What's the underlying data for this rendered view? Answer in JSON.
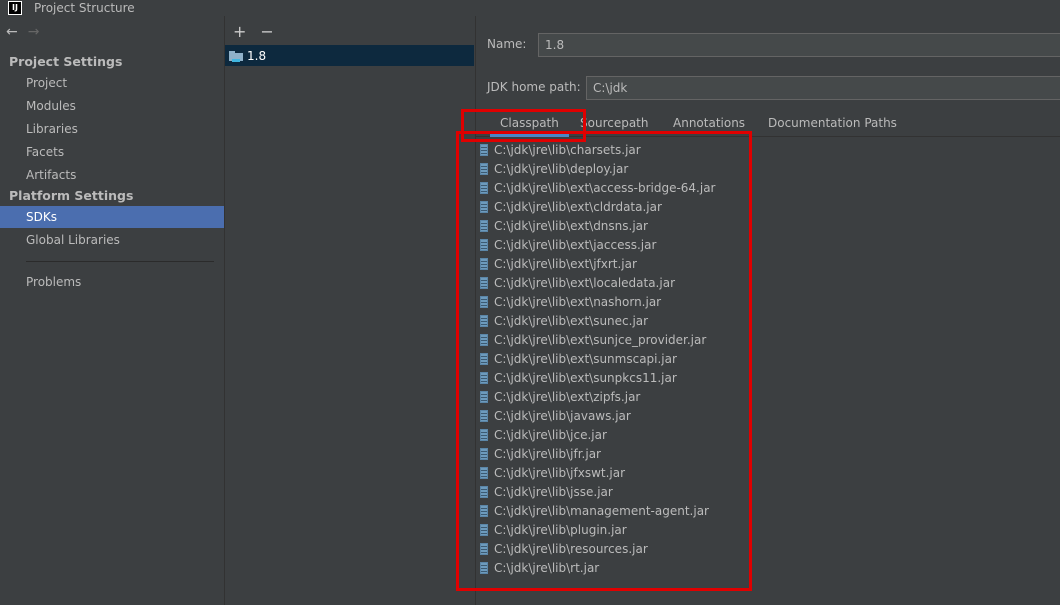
{
  "window": {
    "title": "Project Structure",
    "logo_text": "IJ"
  },
  "nav": {
    "back_glyph": "←",
    "forward_glyph": "→"
  },
  "sidebar": {
    "project_settings_header": "Project Settings",
    "platform_settings_header": "Platform Settings",
    "items": [
      {
        "label": "Project"
      },
      {
        "label": "Modules"
      },
      {
        "label": "Libraries"
      },
      {
        "label": "Facets"
      },
      {
        "label": "Artifacts"
      },
      {
        "label": "SDKs",
        "selected": true
      },
      {
        "label": "Global Libraries"
      },
      {
        "label": "Problems"
      }
    ]
  },
  "sdk_panel": {
    "add_glyph": "+",
    "remove_glyph": "−",
    "sdks": [
      {
        "name": "1.8",
        "selected": true
      }
    ]
  },
  "detail": {
    "name_label": "Name:",
    "name_value": "1.8",
    "home_label": "JDK home path:",
    "home_value": "C:\\jdk",
    "tabs": [
      "Classpath",
      "Sourcepath",
      "Annotations",
      "Documentation Paths"
    ],
    "active_tab": "Classpath",
    "classpath": [
      "C:\\jdk\\jre\\lib\\charsets.jar",
      "C:\\jdk\\jre\\lib\\deploy.jar",
      "C:\\jdk\\jre\\lib\\ext\\access-bridge-64.jar",
      "C:\\jdk\\jre\\lib\\ext\\cldrdata.jar",
      "C:\\jdk\\jre\\lib\\ext\\dnsns.jar",
      "C:\\jdk\\jre\\lib\\ext\\jaccess.jar",
      "C:\\jdk\\jre\\lib\\ext\\jfxrt.jar",
      "C:\\jdk\\jre\\lib\\ext\\localedata.jar",
      "C:\\jdk\\jre\\lib\\ext\\nashorn.jar",
      "C:\\jdk\\jre\\lib\\ext\\sunec.jar",
      "C:\\jdk\\jre\\lib\\ext\\sunjce_provider.jar",
      "C:\\jdk\\jre\\lib\\ext\\sunmscapi.jar",
      "C:\\jdk\\jre\\lib\\ext\\sunpkcs11.jar",
      "C:\\jdk\\jre\\lib\\ext\\zipfs.jar",
      "C:\\jdk\\jre\\lib\\javaws.jar",
      "C:\\jdk\\jre\\lib\\jce.jar",
      "C:\\jdk\\jre\\lib\\jfr.jar",
      "C:\\jdk\\jre\\lib\\jfxswt.jar",
      "C:\\jdk\\jre\\lib\\jsse.jar",
      "C:\\jdk\\jre\\lib\\management-agent.jar",
      "C:\\jdk\\jre\\lib\\plugin.jar",
      "C:\\jdk\\jre\\lib\\resources.jar",
      "C:\\jdk\\jre\\lib\\rt.jar"
    ]
  },
  "colors": {
    "accent": "#4b6eaf",
    "annotation": "#e00000",
    "background": "#3c3f41"
  }
}
